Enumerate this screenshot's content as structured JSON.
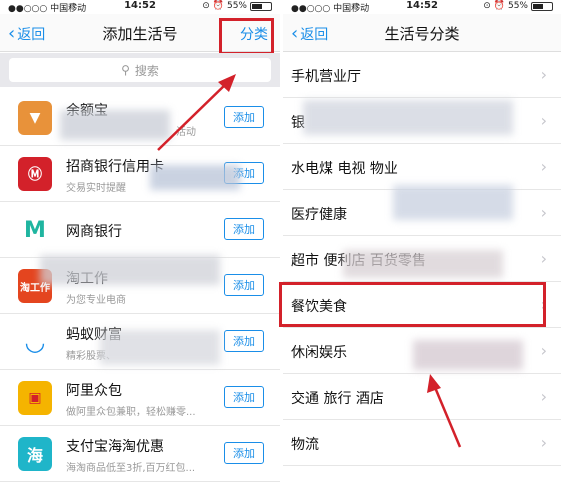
{
  "status": {
    "carrier": "中国移动",
    "time": "14:52",
    "battery": "55%"
  },
  "left": {
    "nav": {
      "back": "返回",
      "title": "添加生活号",
      "right": "分类"
    },
    "search_placeholder": "搜索",
    "add_label": "添加",
    "items": [
      {
        "name": "余额宝",
        "desc": "活动",
        "logo_color": "#e8923a",
        "logo_icon": "pouch-icon"
      },
      {
        "name": "招商银行信用卡",
        "desc": "交易实时提醒",
        "logo_color": "#d3212a",
        "logo_icon": "cmb-icon"
      },
      {
        "name": "网商银行",
        "desc": "",
        "logo_color": "#1fb5a0",
        "logo_icon": "m-icon"
      },
      {
        "name": "淘工作",
        "desc": "为您专业电商",
        "logo_color": "#e4451f",
        "logo_icon": "taogongzuo-icon"
      },
      {
        "name": "蚂蚁财富",
        "desc": "精彩股票、",
        "logo_color": "#1a8ee8",
        "logo_icon": "ant-icon"
      },
      {
        "name": "阿里众包",
        "desc": "做阿里众包兼职，轻松赚零...",
        "logo_color": "#f5b400",
        "logo_icon": "stamp-icon"
      },
      {
        "name": "支付宝海淘优惠",
        "desc": "海淘商品低至3折,百万红包...",
        "logo_color": "#1fb5c9",
        "logo_icon": "hai-icon"
      }
    ]
  },
  "right": {
    "nav": {
      "back": "返回",
      "title": "生活号分类"
    },
    "categories": [
      "手机营业厅",
      "银",
      "水电煤 电视 物业",
      "医疗健康",
      "超市 便利店 百货零售",
      "餐饮美食",
      "休闲娱乐",
      "交通 旅行 酒店",
      "物流"
    ]
  },
  "colors": {
    "accent": "#1a8ee8",
    "highlight": "#d3212a"
  }
}
